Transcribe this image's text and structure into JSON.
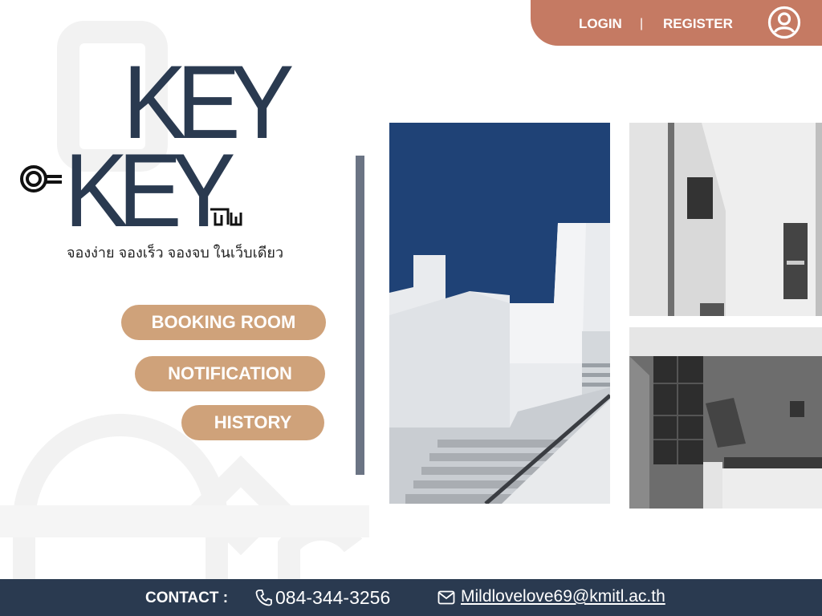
{
  "nav": {
    "login": "LOGIN",
    "separator": "|",
    "register": "REGISTER",
    "avatar_icon": "user-circle-icon"
  },
  "brand": {
    "line1": "KEY",
    "line2": "KEY",
    "tagline": "จองง่าย จองเร็ว จองจบ ในเว็บเดียว",
    "color": "#2a3a50"
  },
  "menu": {
    "booking": "BOOKING ROOM",
    "notification": "NOTIFICATION",
    "history": "HISTORY",
    "color": "#cfa27a"
  },
  "footer": {
    "contact_label": "CONTACT :",
    "phone": "084-344-3256",
    "email": "Mildlovelove69@kmitl.ac.th",
    "phone_icon": "phone-icon",
    "mail_icon": "mail-icon"
  },
  "colors": {
    "accent": "#c57a63",
    "navy": "#2a3a50",
    "button": "#cfa27a"
  }
}
